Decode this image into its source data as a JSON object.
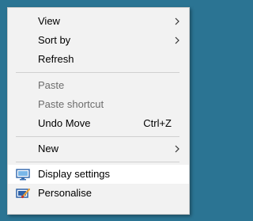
{
  "context_menu": {
    "items": [
      {
        "label": "View",
        "icon": "chevron-right-icon"
      },
      {
        "label": "Sort by",
        "icon": "chevron-right-icon"
      },
      {
        "label": "Refresh"
      },
      {
        "label": "Paste",
        "disabled": true
      },
      {
        "label": "Paste shortcut",
        "disabled": true
      },
      {
        "label": "Undo Move",
        "shortcut": "Ctrl+Z"
      },
      {
        "label": "New",
        "icon": "chevron-right-icon"
      },
      {
        "label": "Display settings",
        "icon": "display-settings-icon",
        "highlighted": true
      },
      {
        "label": "Personalise",
        "icon": "personalise-icon"
      }
    ]
  },
  "colors": {
    "desktop_background": "#2b7493",
    "menu_background": "#f2f2f2",
    "highlight": "#ffffff",
    "disabled_text": "#6d6d6d"
  }
}
